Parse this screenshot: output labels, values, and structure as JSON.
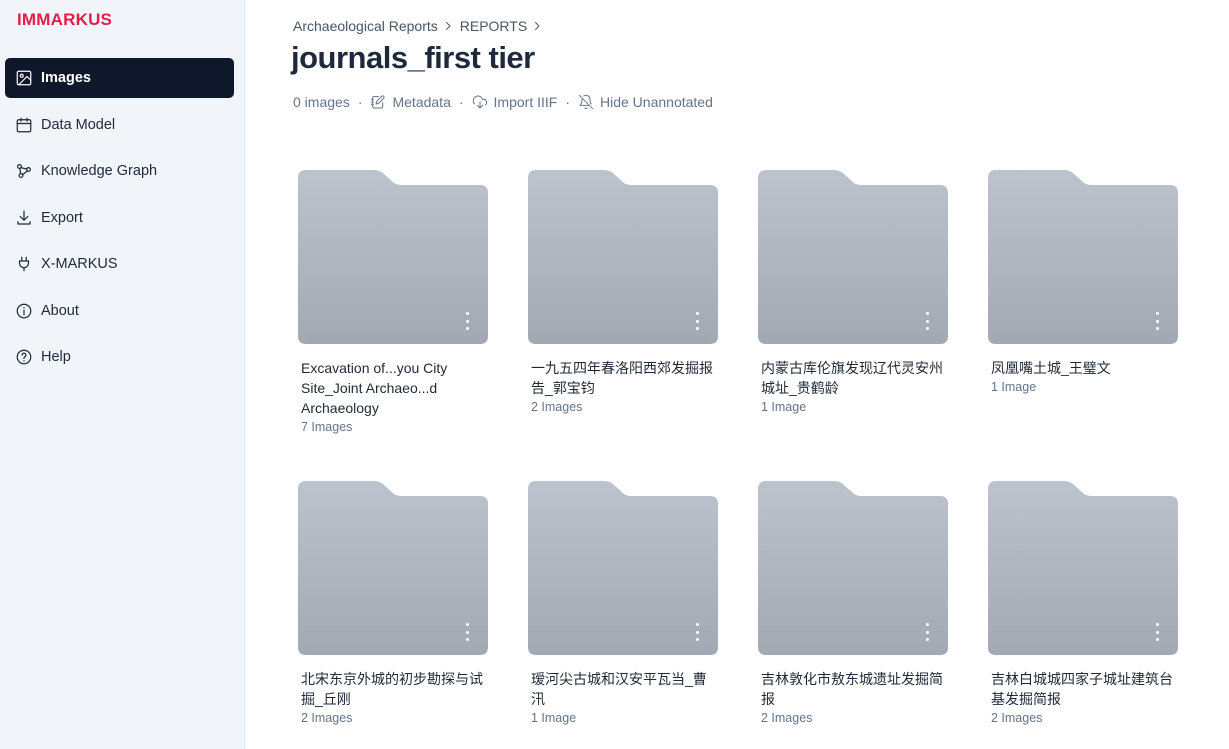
{
  "brand": "IMMARKUS",
  "sidebar": {
    "items": [
      {
        "label": "Images",
        "icon": "image-icon",
        "active": true
      },
      {
        "label": "Data Model",
        "icon": "calendar-icon",
        "active": false
      },
      {
        "label": "Knowledge Graph",
        "icon": "graph-icon",
        "active": false
      },
      {
        "label": "Export",
        "icon": "download-icon",
        "active": false
      },
      {
        "label": "X-MARKUS",
        "icon": "plug-icon",
        "active": false
      },
      {
        "label": "About",
        "icon": "info-icon",
        "active": false
      },
      {
        "label": "Help",
        "icon": "help-icon",
        "active": false
      }
    ]
  },
  "breadcrumb": [
    "Archaeological Reports",
    "REPORTS"
  ],
  "page_title": "journals_first tier",
  "meta": {
    "image_count": "0 images",
    "separator": "·",
    "metadata_label": "Metadata",
    "import_label": "Import IIIF",
    "hide_label": "Hide Unannotated"
  },
  "folders": [
    {
      "title": "Excavation of...you City Site_Joint Archaeo...d Archaeology",
      "count": "7 Images"
    },
    {
      "title": "一九五四年春洛阳西郊发掘报告_郭宝钧",
      "count": "2 Images"
    },
    {
      "title": "内蒙古库伦旗发现辽代灵安州城址_贵鹤龄",
      "count": "1 Image"
    },
    {
      "title": "凤凰嘴土城_王璧文",
      "count": "1 Image"
    },
    {
      "title": "北宋东京外城的初步勘探与试掘_丘刚",
      "count": "2 Images"
    },
    {
      "title": "瑷河尖古城和汉安平瓦当_曹汛",
      "count": "1 Image"
    },
    {
      "title": "吉林敦化市敖东城遗址发掘简报",
      "count": "2 Images"
    },
    {
      "title": "吉林白城城四家子城址建筑台基发掘简报",
      "count": "2 Images"
    }
  ],
  "colors": {
    "brand": "#e11d48",
    "active_nav_bg": "#0f172a",
    "sidebar_bg": "#f1f5f9",
    "folder_top": "#bcc3cc",
    "folder_bottom": "#a3a9b3"
  }
}
